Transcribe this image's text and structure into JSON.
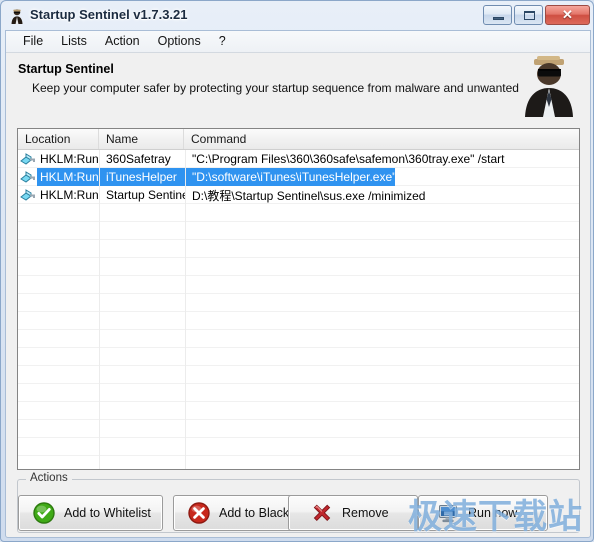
{
  "window": {
    "title": "Startup Sentinel v1.7.3.21",
    "title_icon": "sentinel-app-icon",
    "buttons": {
      "minimize": "minimize-icon",
      "maximize": "maximize-icon",
      "close_glyph": "✕"
    }
  },
  "menu": {
    "items": [
      {
        "label": "File"
      },
      {
        "label": "Lists"
      },
      {
        "label": "Action"
      },
      {
        "label": "Options"
      },
      {
        "label": "?"
      }
    ]
  },
  "header": {
    "heading": "Startup Sentinel",
    "subheading": "Keep your computer safer by protecting your startup sequence from malware and unwanted software",
    "avatar_icon": "sentinel-guard-avatar"
  },
  "list": {
    "columns": [
      {
        "label": "Location"
      },
      {
        "label": "Name"
      },
      {
        "label": "Command"
      }
    ],
    "rows": [
      {
        "icon": "registry-key-icon",
        "location": "HKLM:Run",
        "name": "360Safetray",
        "command": "\"C:\\Program Files\\360\\360safe\\safemon\\360tray.exe\" /start",
        "selected": false
      },
      {
        "icon": "registry-key-icon",
        "location": "HKLM:Run",
        "name": "iTunesHelper",
        "command": "\"D:\\software\\iTunes\\iTunesHelper.exe\"",
        "selected": true
      },
      {
        "icon": "registry-key-icon",
        "location": "HKLM:Run",
        "name": "Startup Sentinel",
        "command": "D:\\教程\\Startup Sentinel\\sus.exe /minimized",
        "selected": false
      }
    ]
  },
  "actions": {
    "legend": "Actions",
    "buttons": [
      {
        "label": "Add to Whitelist",
        "icon": "green-check-circle-icon"
      },
      {
        "label": "Add to Blacklist",
        "icon": "red-x-circle-icon"
      },
      {
        "label": "Remove",
        "icon": "red-cross-icon"
      },
      {
        "label": "Run now",
        "icon": "monitor-icon"
      }
    ]
  },
  "watermark": {
    "text": "极速下载站"
  },
  "colors": {
    "selection": "#2f93f0",
    "whitelist_accent": "#3faa16",
    "blacklist_accent": "#c8281c",
    "remove_accent": "#c0272d",
    "watermark": "#68a0d6"
  }
}
